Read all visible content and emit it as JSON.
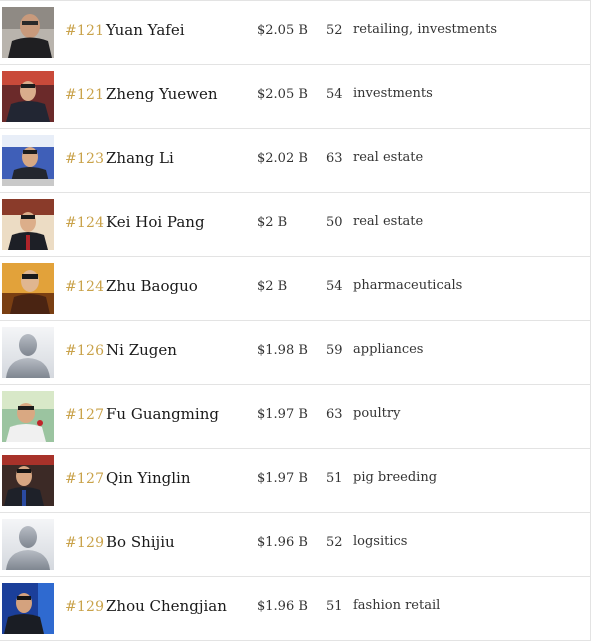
{
  "rows": [
    {
      "rank": "#121",
      "name": "Yuan Yafei",
      "worth": "$2.05 B",
      "age": "52",
      "industry": "retailing, investments",
      "photo": "photo"
    },
    {
      "rank": "#121",
      "name": "Zheng Yuewen",
      "worth": "$2.05 B",
      "age": "54",
      "industry": "investments",
      "photo": "photo"
    },
    {
      "rank": "#123",
      "name": "Zhang Li",
      "worth": "$2.02 B",
      "age": "63",
      "industry": "real estate",
      "photo": "photo"
    },
    {
      "rank": "#124",
      "name": "Kei Hoi Pang",
      "worth": "$2 B",
      "age": "50",
      "industry": "real estate",
      "photo": "photo"
    },
    {
      "rank": "#124",
      "name": "Zhu Baoguo",
      "worth": "$2 B",
      "age": "54",
      "industry": "pharmaceuticals",
      "photo": "photo"
    },
    {
      "rank": "#126",
      "name": "Ni Zugen",
      "worth": "$1.98 B",
      "age": "59",
      "industry": "appliances",
      "photo": "placeholder"
    },
    {
      "rank": "#127",
      "name": "Fu Guangming",
      "worth": "$1.97 B",
      "age": "63",
      "industry": "poultry",
      "photo": "photo"
    },
    {
      "rank": "#127",
      "name": "Qin Yinglin",
      "worth": "$1.97 B",
      "age": "51",
      "industry": "pig breeding",
      "photo": "photo"
    },
    {
      "rank": "#129",
      "name": "Bo Shijiu",
      "worth": "$1.96 B",
      "age": "52",
      "industry": "logsitics",
      "photo": "placeholder"
    },
    {
      "rank": "#129",
      "name": "Zhou Chengjian",
      "worth": "$1.96 B",
      "age": "51",
      "industry": "fashion retail",
      "photo": "photo"
    }
  ],
  "colors": {
    "rank": "#c9a24a",
    "divider": "#e3e3e3",
    "text": "#1a1a1a"
  }
}
